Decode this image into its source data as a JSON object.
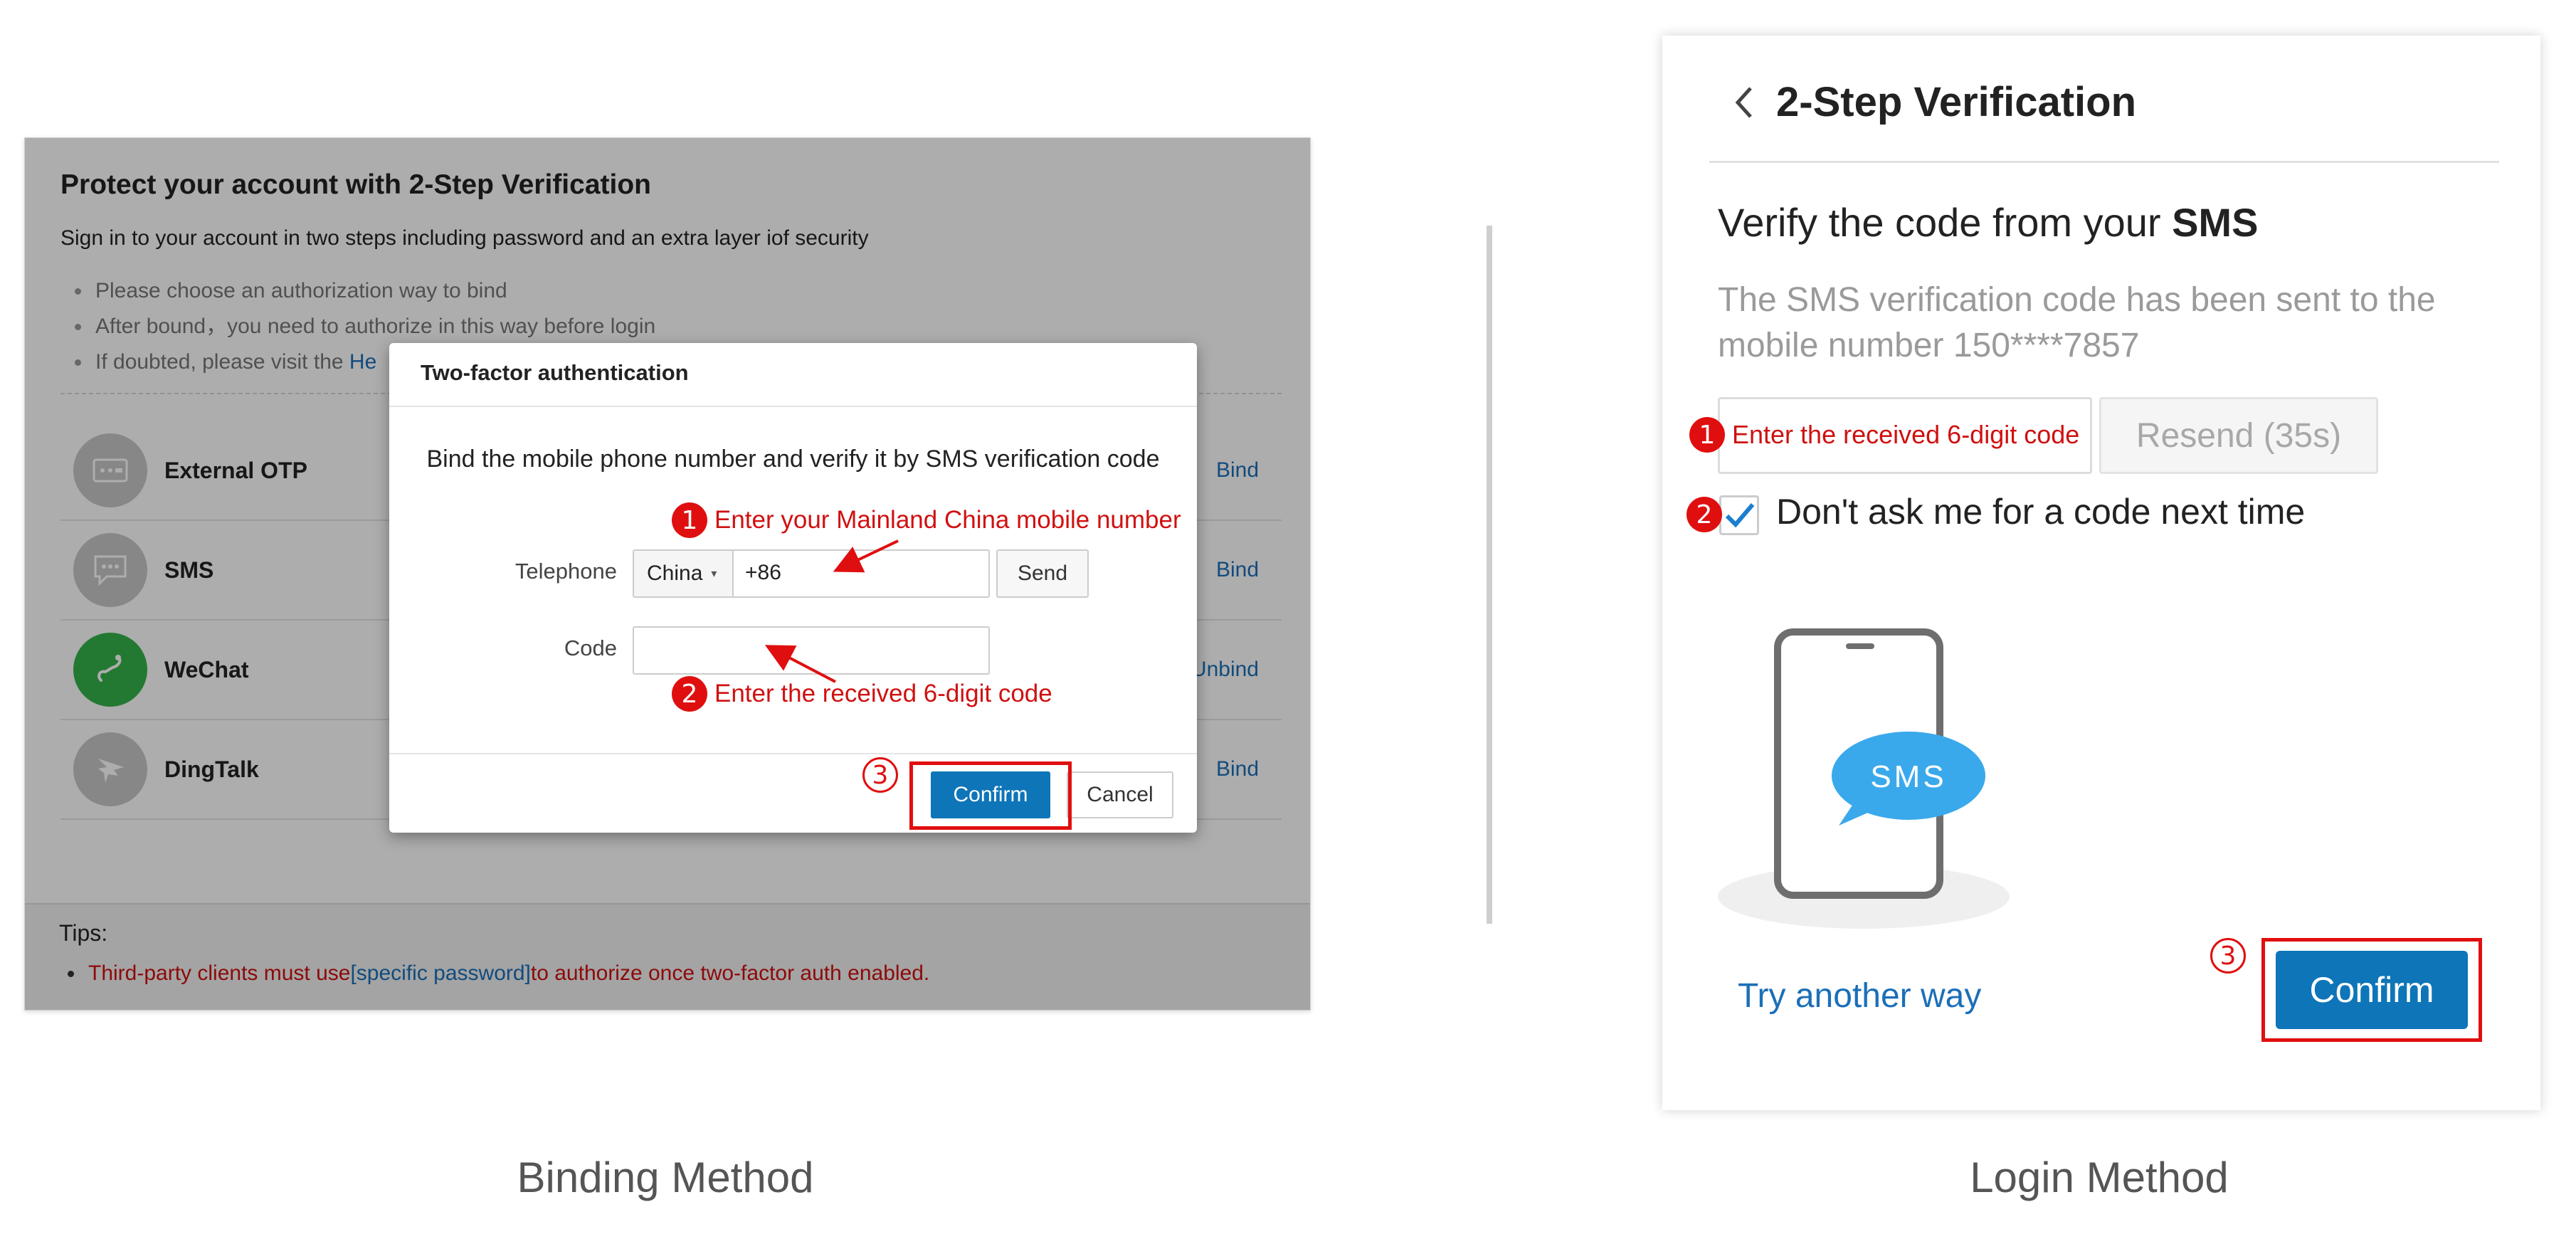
{
  "binding": {
    "panel_title": "Protect your account with 2-Step Verification",
    "panel_subtitle": "Sign in to your account in two steps including password and an extra layer iof security",
    "bullets": [
      "Please choose an authorization way to bind",
      "After bound，you need to authorize in this way before login",
      "If doubted, please visit the "
    ],
    "help_link": "He",
    "methods": [
      {
        "name": "External OTP",
        "action": "Bind",
        "icon": "otp-icon"
      },
      {
        "name": "SMS",
        "action": "Bind",
        "icon": "sms-icon"
      },
      {
        "name": "WeChat",
        "action": "Unbind",
        "icon": "wechat-icon"
      },
      {
        "name": "DingTalk",
        "action": "Bind",
        "icon": "dingtalk-icon"
      }
    ],
    "tips_title": "Tips",
    "tips_colon": ":",
    "tips_text_1": "Third-party clients must use ",
    "tips_link": "[specific password]",
    "tips_text_2": " to authorize once two-factor auth enabled.",
    "dialog": {
      "title": "Two-factor authentication",
      "description": "Bind the mobile phone number and verify it by SMS verification code",
      "telephone_label": "Telephone",
      "country": "China",
      "country_code": "+86",
      "send_label": "Send",
      "code_label": "Code",
      "confirm_label": "Confirm",
      "cancel_label": "Cancel"
    },
    "annotations": {
      "step1": "Enter your Mainland China mobile number",
      "step2": "Enter the received 6-digit code",
      "n1": "1",
      "n2": "2",
      "n3": "3"
    },
    "caption": "Binding Method"
  },
  "login": {
    "title": "2-Step Verification",
    "heading_prefix": "Verify the code from your ",
    "heading_bold": "SMS",
    "subtext": "The SMS verification code has been sent to the mobile number 150****7857",
    "code_annotation": "Enter the received 6-digit code",
    "resend_label": "Resend (35s)",
    "checkbox_label": "Don't ask me for a code next time",
    "phone_bubble": "SMS",
    "try_another": "Try another way",
    "confirm_label": "Confirm",
    "annotations": {
      "n1": "1",
      "n2": "2",
      "n3": "3"
    },
    "caption": "Login Method"
  },
  "colors": {
    "accent_blue": "#0e75b8",
    "link_blue": "#1b6fb8",
    "annotation_red": "#e00f0f",
    "wechat_green": "#35b34a"
  }
}
